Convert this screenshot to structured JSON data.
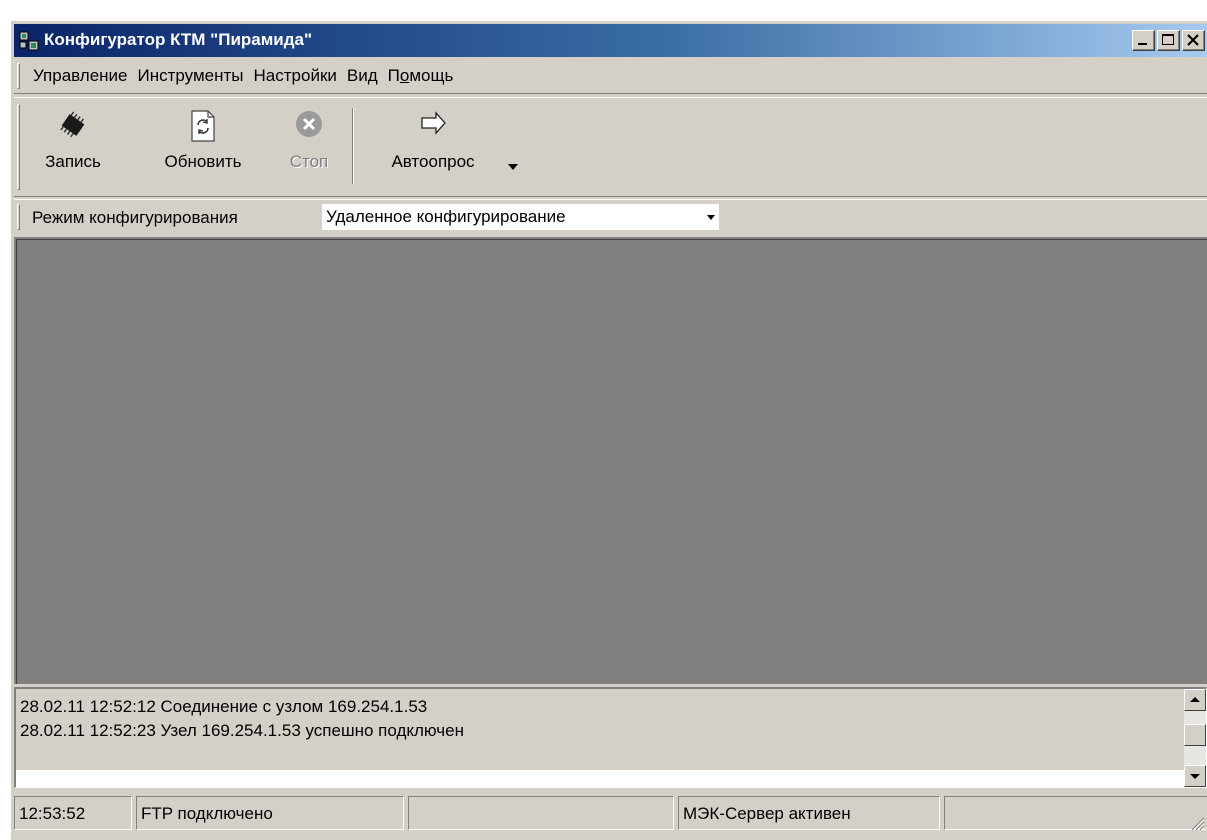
{
  "window": {
    "title": "Конфигуратор КТМ \"Пирамида\"",
    "controls": [
      "minimize",
      "maximize",
      "close"
    ]
  },
  "menu": {
    "items": [
      {
        "label": "Управление"
      },
      {
        "label": "Инструменты"
      },
      {
        "label": "Настройки"
      },
      {
        "label": "Вид"
      },
      {
        "label_before": "П",
        "label_mnemonic": "о",
        "label_after": "мощь"
      }
    ]
  },
  "toolbar": {
    "write": {
      "label": "Запись",
      "icon": "chip-icon"
    },
    "refresh": {
      "label": "Обновить",
      "icon": "refresh-document-icon"
    },
    "stop": {
      "label": "Стоп",
      "icon": "stop-icon",
      "disabled": true
    },
    "autopoll": {
      "label": "Автоопрос",
      "icon": "arrow-right-icon"
    }
  },
  "mode": {
    "label": "Режим конфигурирования",
    "selected": "Удаленное конфигурирование"
  },
  "log": {
    "lines": [
      "28.02.11 12:52:12 Соединение с узлом 169.254.1.53",
      "28.02.11 12:52:23 Узел 169.254.1.53 успешно подключен"
    ]
  },
  "status": {
    "time": "12:53:52",
    "ftp": "FTP подключено",
    "empty1": "",
    "iec": "МЭК-Сервер активен",
    "empty2": ""
  }
}
